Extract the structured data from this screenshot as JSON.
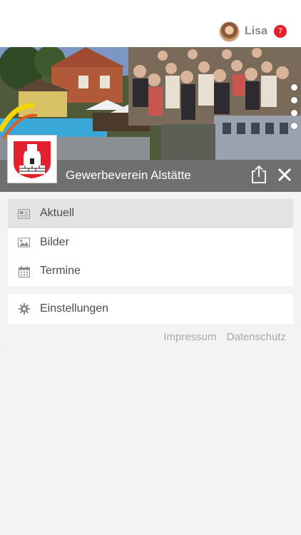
{
  "user": {
    "name": "Lisa",
    "notification_count": "7"
  },
  "hero": {
    "org_name": "Gewerbeverein Alstätte",
    "carousel_pages": 4
  },
  "menu": {
    "items": [
      {
        "label": "Aktuell",
        "icon": "newspaper-icon",
        "active": true
      },
      {
        "label": "Bilder",
        "icon": "image-icon",
        "active": false
      },
      {
        "label": "Termine",
        "icon": "calendar-icon",
        "active": false
      }
    ]
  },
  "settings": {
    "label": "Einstellungen",
    "icon": "gear-icon"
  },
  "footer": {
    "impressum": "Impressum",
    "datenschutz": "Datenschutz"
  },
  "colors": {
    "badge": "#e2212d",
    "bar": "#6f6f6f",
    "active_item": "#e3e3e3"
  }
}
